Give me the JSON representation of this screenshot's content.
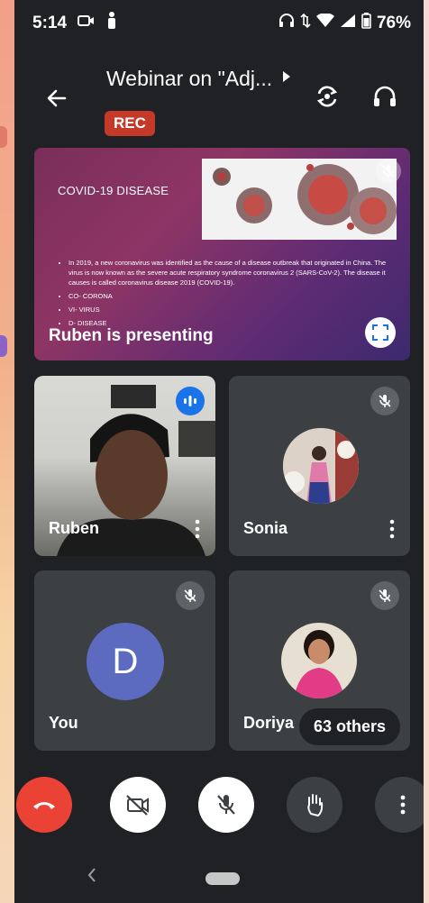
{
  "status_bar": {
    "time": "5:14",
    "battery": "76%"
  },
  "header": {
    "title": "Webinar on \"Adj...",
    "rec_badge": "REC"
  },
  "presentation": {
    "slide_title": "COVID-19 DISEASE",
    "bullets": [
      "In 2019, a new coronavirus was identified as the cause of a disease outbreak that originated in China. The virus is now known as the severe acute respiratory syndrome coronavirus 2 (SARS-CoV-2). The disease it causes is called coronavirus disease 2019 (COVID-19).",
      "CO- CORONA",
      "VI- VIRUS",
      "D- DISEASE"
    ],
    "presenter_label": "Ruben is presenting"
  },
  "participants": [
    {
      "name": "Ruben"
    },
    {
      "name": "Sonia"
    },
    {
      "name": "You",
      "initial": "D"
    },
    {
      "name": "Doriya"
    }
  ],
  "others_count": "63 others",
  "colors": {
    "end_call": "#ea4335",
    "rec": "#c53929",
    "avatar_d": "#5c6bc0",
    "speaking": "#1a73e8"
  },
  "icons": [
    "back-arrow-icon",
    "play-right-icon",
    "switch-camera-icon",
    "headphones-icon",
    "mic-off-icon",
    "fullscreen-icon",
    "audio-level-icon",
    "more-vert-icon",
    "end-call-icon",
    "video-off-icon",
    "raise-hand-icon"
  ]
}
